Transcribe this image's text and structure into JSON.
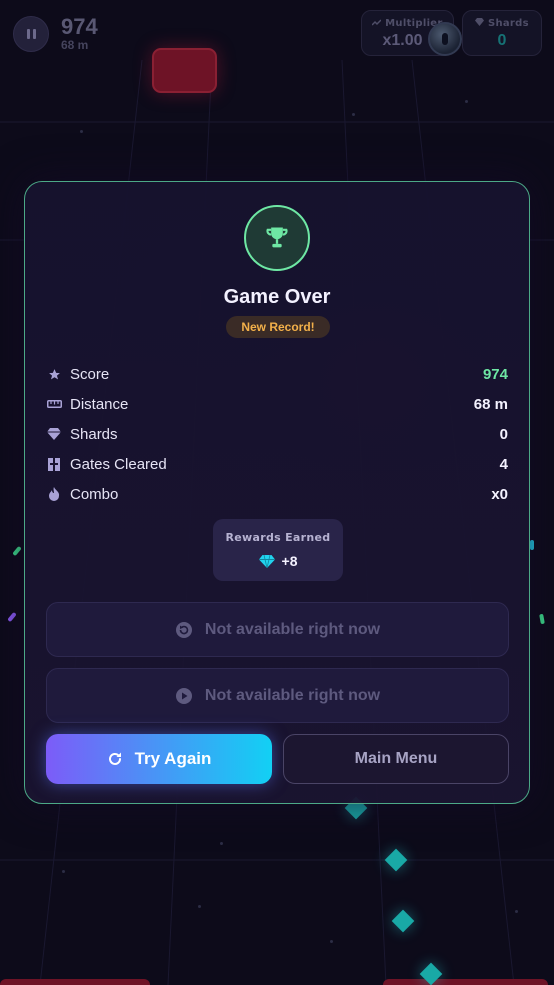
{
  "hud": {
    "score": "974",
    "distance": "68 m",
    "multiplier_label": "Multiplier",
    "multiplier_value": "x1.00",
    "shards_label": "Shards",
    "shards_value": "0"
  },
  "modal": {
    "title": "Game Over",
    "badge": "New Record!",
    "stats": [
      {
        "icon": "star-icon",
        "label": "Score",
        "value": "974"
      },
      {
        "icon": "ruler-icon",
        "label": "Distance",
        "value": "68 m"
      },
      {
        "icon": "gem-icon",
        "label": "Shards",
        "value": "0"
      },
      {
        "icon": "gate-icon",
        "label": "Gates Cleared",
        "value": "4"
      },
      {
        "icon": "flame-icon",
        "label": "Combo",
        "value": "x0"
      }
    ],
    "rewards_label": "Rewards Earned",
    "rewards_amount": "+8",
    "revive_label": "Not available right now",
    "double_label": "Not available right now",
    "try_again_label": "Try Again",
    "main_menu_label": "Main Menu"
  },
  "colors": {
    "accent_green": "#6ee7a4",
    "badge_gold": "#f2b04a",
    "gem_cyan": "#22d3ee",
    "try_gradient_start": "#7c5cf8",
    "try_gradient_end": "#12d0f4"
  }
}
